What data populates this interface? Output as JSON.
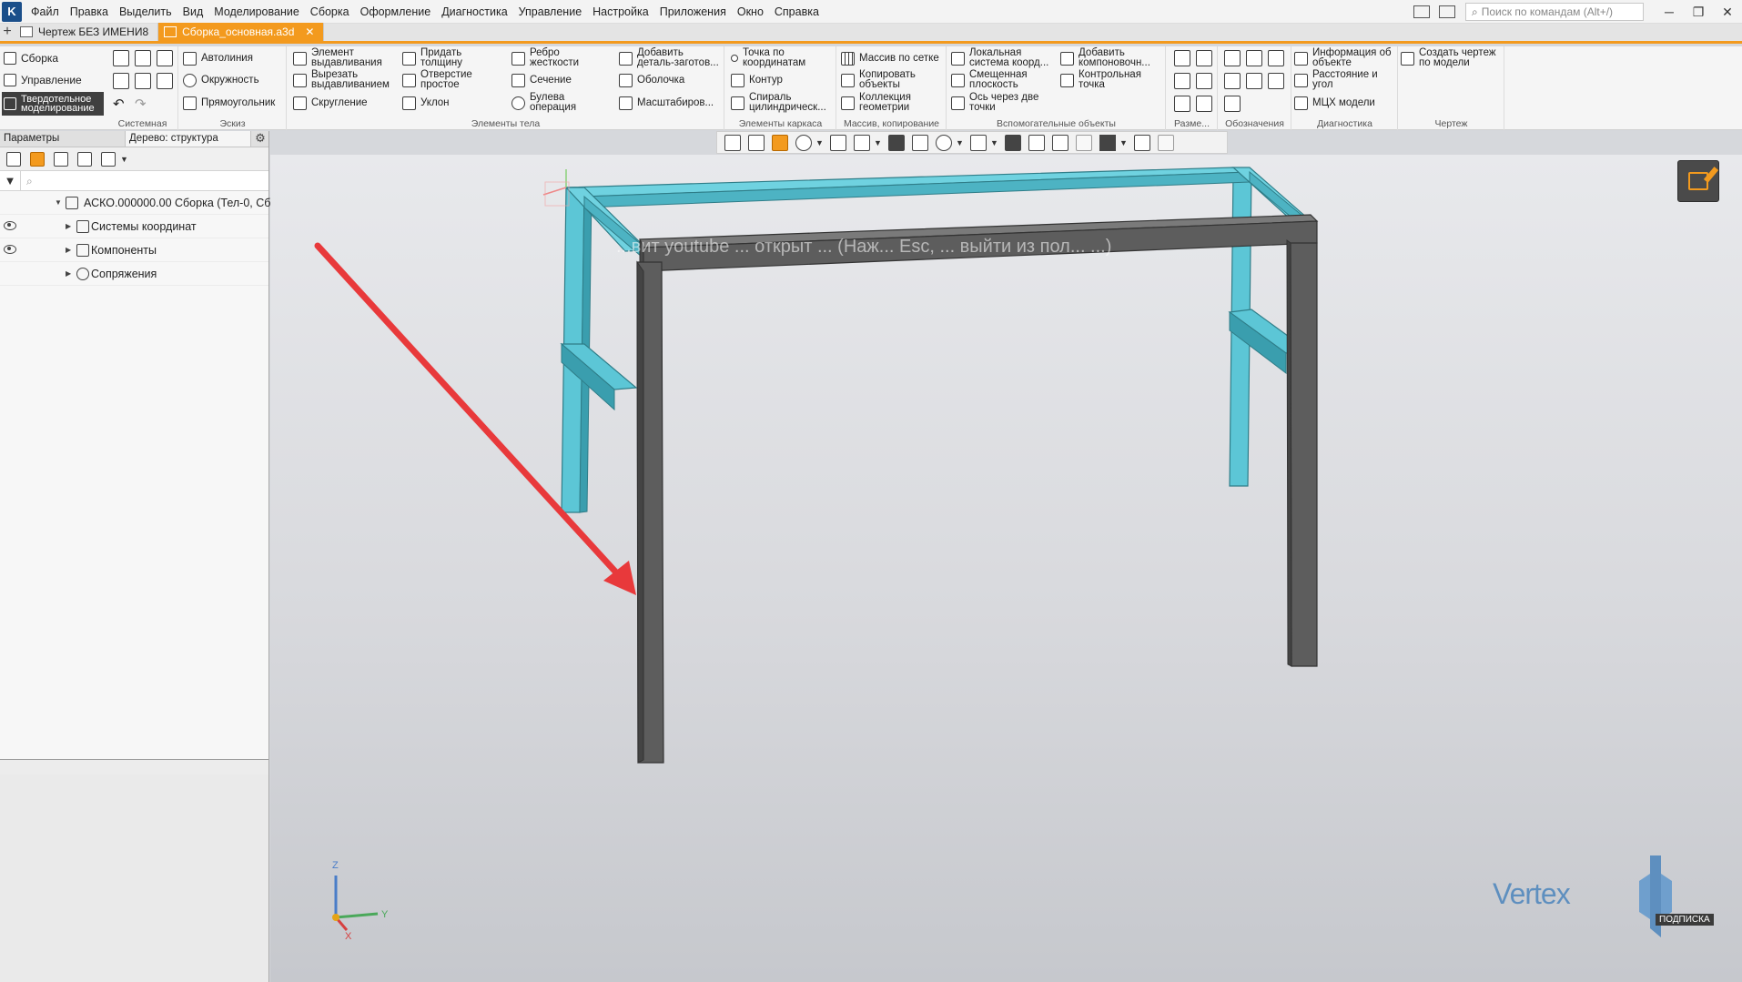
{
  "menubar": {
    "items": [
      "Файл",
      "Правка",
      "Выделить",
      "Вид",
      "Моделирование",
      "Сборка",
      "Оформление",
      "Диагностика",
      "Управление",
      "Настройка",
      "Приложения",
      "Окно",
      "Справка"
    ],
    "search_placeholder": "Поиск по командам (Alt+/)"
  },
  "doctabs": [
    {
      "label": "Чертеж БЕЗ ИМЕНИ8",
      "active": false
    },
    {
      "label": "Сборка_основная.a3d",
      "active": true
    }
  ],
  "ribbon": {
    "modes": [
      "Сборка",
      "Управление",
      "Твердотельное моделирование"
    ],
    "group_labels": {
      "system": "Системная",
      "sketch": "Эскиз",
      "body": "Элементы тела",
      "frame": "Элементы каркаса",
      "array": "Массив, копирование",
      "aux": "Вспомогательные объекты",
      "dims": "Разме...",
      "marks": "Обозначения",
      "diag": "Диагностика",
      "drawing": "Чертеж"
    },
    "sketch": [
      "Автолиния",
      "Окружность",
      "Прямоугольник"
    ],
    "body_col1": [
      "Элемент выдавливания",
      "Вырезать выдавливанием",
      "Скругление"
    ],
    "body_col2": [
      "Придать толщину",
      "Отверстие простое",
      "Уклон"
    ],
    "body_col3": [
      "Ребро жесткости",
      "Сечение",
      "Булева операция"
    ],
    "body_col4": [
      "Добавить деталь-заготов...",
      "Оболочка",
      "Масштабиров..."
    ],
    "frame": [
      "Точка по координатам",
      "Контур",
      "Спираль цилиндрическ..."
    ],
    "array": [
      "Массив по сетке",
      "Копировать объекты",
      "Коллекция геометрии"
    ],
    "aux_col1": [
      "Локальная система коорд...",
      "Смещенная плоскость",
      "Ось через две точки"
    ],
    "aux_col2": [
      "Добавить компоновочн...",
      "Контрольная точка"
    ],
    "diag": [
      "Информация об объекте",
      "Расстояние и угол",
      "МЦХ модели"
    ],
    "drawing": [
      "Создать чертеж по модели"
    ]
  },
  "panel": {
    "tab_params": "Параметры",
    "tab_tree": "Дерево: структура",
    "tree": [
      {
        "label": "АСКО.000000.00 Сборка (Тел-0, Сб",
        "level": 0,
        "eye": false
      },
      {
        "label": "Системы координат",
        "level": 1,
        "eye": true
      },
      {
        "label": "Компоненты",
        "level": 1,
        "eye": true
      },
      {
        "label": "Сопряжения",
        "level": 1,
        "eye": false
      }
    ]
  },
  "viewport": {
    "overlay_text": "...вит youtube ... открыт ... (Наж... Esc, ... выйти из пол... ...)",
    "axis_labels": [
      "Z",
      "Y",
      "X"
    ]
  },
  "watermark": {
    "brand": "Vertex",
    "subscribe": "ПОДПИСКА"
  },
  "colors": {
    "accent": "#f39a1e",
    "selected_part": "#5cc6d6",
    "frame_part": "#5d5d5d",
    "arrow": "#e8393b"
  }
}
